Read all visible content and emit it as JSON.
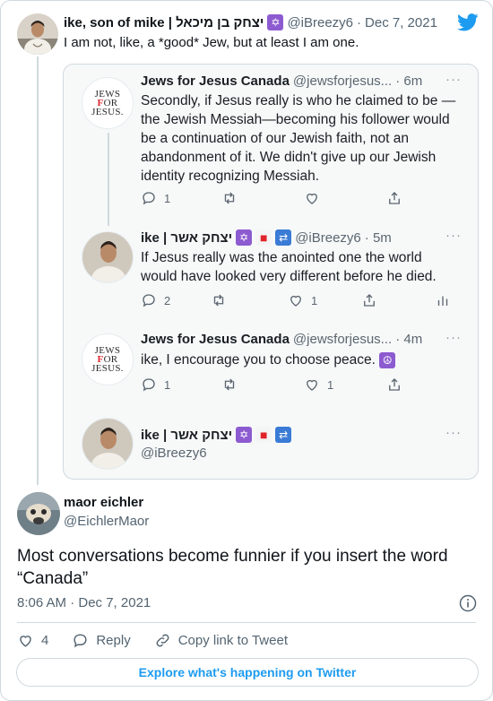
{
  "parent": {
    "name": "ike, son of mike | יצחק בן מיכאל",
    "handle": "@iBreezy6",
    "sep": "·",
    "date": "Dec 7, 2021",
    "text": "I am not, like, a *good* Jew, but at least I am one."
  },
  "screenshot": {
    "tweets": [
      {
        "name": "Jews for Jesus Canada",
        "handle": "@jewsforjesus...",
        "time": "· 6m",
        "text": "Secondly, if Jesus really is who he claimed to be —the Jewish Messiah—becoming his follower would be a continuation of our Jewish faith, not an abandonment of it. We didn't give up our Jewish identity recognizing Messiah.",
        "replies": "1",
        "likes": ""
      },
      {
        "name": "ike | יצחק אשר",
        "handle": "@iBreezy6",
        "time": "· 5m",
        "text": "If Jesus really was the anointed one the world would have looked very different before he died.",
        "replies": "2",
        "likes": "1"
      },
      {
        "name": "Jews for Jesus Canada",
        "handle": "@jewsforjesus...",
        "time": "· 4m",
        "text": "ike, I encourage you to choose peace.",
        "replies": "1",
        "likes": "1"
      },
      {
        "name": "ike | יצחק אשר",
        "handle": "@iBreezy6"
      }
    ],
    "logo_lines": [
      "JEWS",
      "FOR",
      "JESUS."
    ],
    "more": "···"
  },
  "main": {
    "name": "maor eichler",
    "handle": "@EichlerMaor",
    "text": "Most conversations become funnier if you insert the word “Canada”",
    "time": "8:06 AM · Dec 7, 2021",
    "likes": "4",
    "reply_label": "Reply",
    "copy_label": "Copy link to Tweet",
    "explore_label": "Explore what's happening on Twitter"
  },
  "colors": {
    "accent": "#1d9bf0",
    "muted": "#536471",
    "border": "#cfd9de",
    "shot_bg": "#f7f9f9"
  },
  "icons": [
    "twitter-logo-icon",
    "reply-icon",
    "retweet-icon",
    "like-icon",
    "share-icon",
    "analytics-icon",
    "info-icon",
    "link-icon"
  ]
}
